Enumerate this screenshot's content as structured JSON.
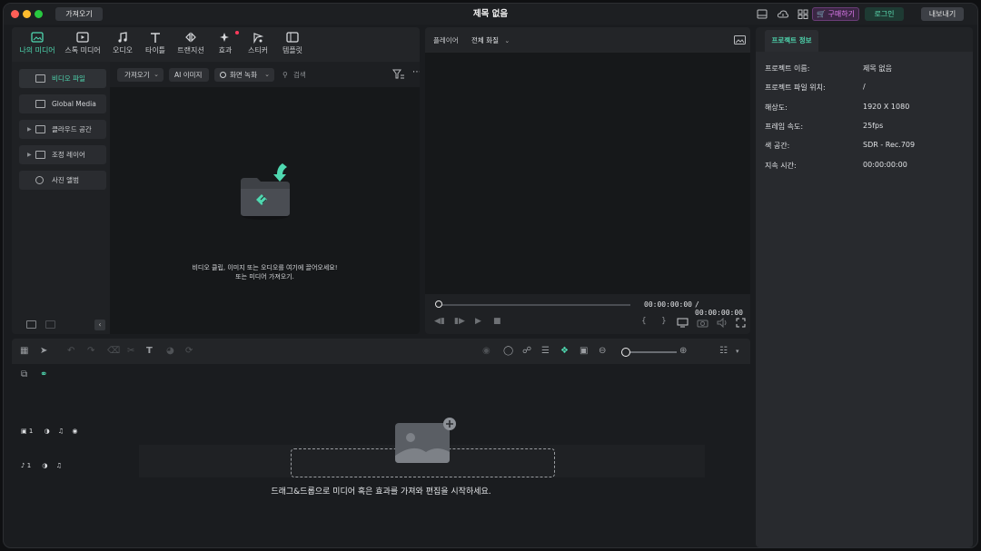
{
  "titlebar": {
    "import_label": "가져오기",
    "title": "제목 없음",
    "buy_label": "구매하기",
    "login_label": "로그인",
    "export_label": "내보내기"
  },
  "media_tabs": [
    {
      "label": "나의 미디어",
      "icon": "my-media-icon",
      "active": true
    },
    {
      "label": "스톡 미디어",
      "icon": "stock-media-icon"
    },
    {
      "label": "오디오",
      "icon": "music-note-icon"
    },
    {
      "label": "타이틀",
      "icon": "title-t-icon"
    },
    {
      "label": "트랜지션",
      "icon": "transition-icon"
    },
    {
      "label": "효과",
      "icon": "effects-sparkle-icon",
      "badge": true
    },
    {
      "label": "스티커",
      "icon": "sticker-icon"
    },
    {
      "label": "템플릿",
      "icon": "template-icon"
    }
  ],
  "sidebar": {
    "items": [
      {
        "label": "비디오 파일",
        "active": true
      },
      {
        "label": "Global Media"
      },
      {
        "label": "클라우드 공간",
        "expandable": true
      },
      {
        "label": "조정 레이어",
        "expandable": true
      },
      {
        "label": "사진 앨범"
      }
    ]
  },
  "media_toolbar": {
    "import_dropdown": "가져오기",
    "ai_image": "AI 이미지",
    "screen_record": "화면 녹화",
    "search_placeholder": "검색"
  },
  "media_empty": {
    "line1": "비디오 클립, 이미지 또는 오디오를 여기에 끌어오세요!",
    "line2": "또는 미디어 가져오기."
  },
  "player": {
    "label": "플레이어",
    "quality": "전체 화질",
    "current_time": "00:00:00:00",
    "total_time": "/ 00:00:00:00"
  },
  "properties": {
    "tab_label": "프로젝트 정보",
    "rows": [
      {
        "label": "프로젝트 이름:",
        "value": "제목 없음"
      },
      {
        "label": "프로젝트 파일 위치:",
        "value": "/"
      },
      {
        "label": "해상도:",
        "value": "1920 X 1080"
      },
      {
        "label": "프레임 속도:",
        "value": "25fps"
      },
      {
        "label": "색 공간:",
        "value": "SDR - Rec.709"
      },
      {
        "label": "지속 시간:",
        "value": "00:00:00:00"
      }
    ]
  },
  "timeline": {
    "video_track": "1",
    "audio_track": "1",
    "drop_text": "드래그&드롭으로 미디어 혹은 효과를 가져와 편집을 시작하세요."
  },
  "colors": {
    "accent": "#4fd8b0",
    "buy": "#e07bf0",
    "window_bg": "#1a1c1f"
  }
}
